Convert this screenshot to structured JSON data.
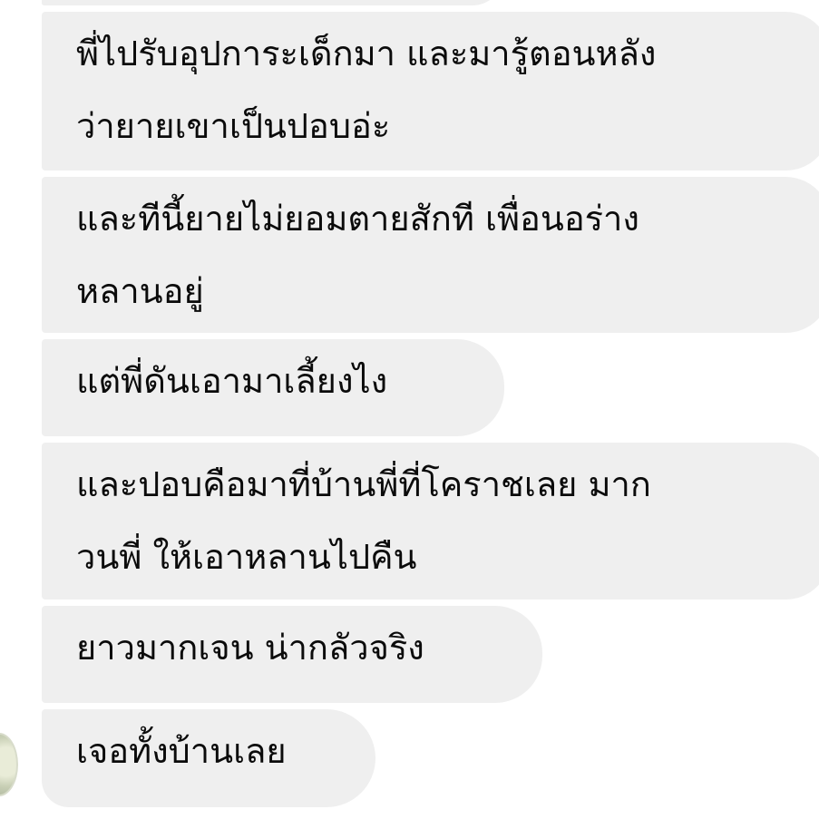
{
  "messages": [
    {
      "lines": [
        ""
      ]
    },
    {
      "lines": [
        "พี่ไปรับอุปการะเด็กมา และมารู้ตอนหลัง",
        "ว่ายายเขาเป็นปอบอ่ะ"
      ]
    },
    {
      "lines": [
        "และทีนี้ยายไม่ยอมตายสักที เพื่อนอร่าง",
        "หลานอยู่"
      ]
    },
    {
      "lines": [
        "แต่พี่ดันเอามาเลี้ยงไง"
      ]
    },
    {
      "lines": [
        "และปอบคือมาที่บ้านพี่ที่โคราชเลย มาก",
        "วนพี่ ให้เอาหลานไปคืน"
      ]
    },
    {
      "lines": [
        "ยาวมากเจน น่ากลัวจริง"
      ]
    },
    {
      "lines": [
        "เจอทั้งบ้านเลย"
      ]
    }
  ],
  "colors": {
    "bubble": "#efefef",
    "text": "#0b0b0b",
    "background": "#ffffff"
  }
}
